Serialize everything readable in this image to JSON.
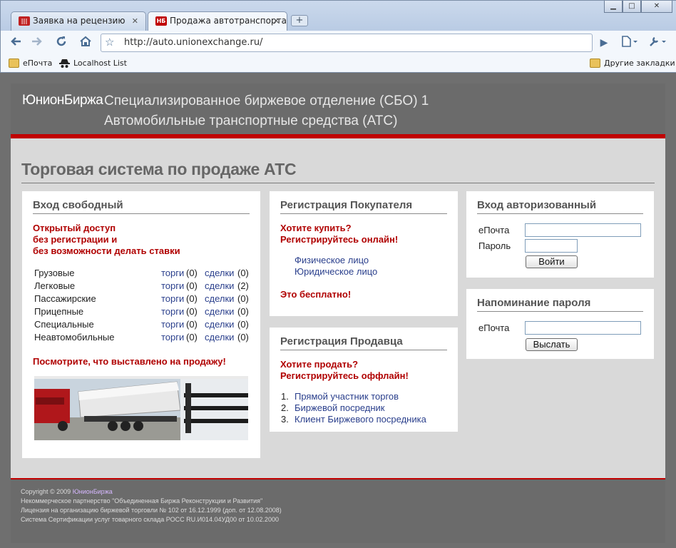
{
  "browser": {
    "tabs": [
      {
        "label": "Заявка на рецензию",
        "favicon_text": "|||",
        "favicon_color": "#c02020"
      },
      {
        "label": "Продажа автотранспорта",
        "favicon_text": "НБ",
        "favicon_color": "#c00000"
      }
    ],
    "new_tab_symbol": "+",
    "window_buttons": {
      "minimize": "▁",
      "maximize": "□",
      "close": "✕"
    },
    "tab_close_symbol": "✕",
    "address_url": "http://auto.unionexchange.ru/",
    "bookmarks": {
      "epochta": "еПочта",
      "localhost": "Localhost List",
      "other": "Другие закладки"
    }
  },
  "header": {
    "logo": "ЮнионБиржа",
    "line1": "Специализированное биржевое отделение (СБО) 1",
    "line2": "Автомобильные транспортные средства (АТС)"
  },
  "page_title": "Торговая система по продаже АТС",
  "free_entry": {
    "title": "Вход свободный",
    "notice": [
      "Открытый доступ",
      "без регистрации и",
      "без возможности делать ставки"
    ],
    "rows": [
      {
        "name": "Грузовые",
        "auctions_label": "торги",
        "auctions": "(0)",
        "deals_label": "сделки",
        "deals": "(0)"
      },
      {
        "name": "Легковые",
        "auctions_label": "торги",
        "auctions": "(0)",
        "deals_label": "сделки",
        "deals": "(2)"
      },
      {
        "name": "Пассажирские",
        "auctions_label": "торги",
        "auctions": "(0)",
        "deals_label": "сделки",
        "deals": "(0)"
      },
      {
        "name": "Прицепные",
        "auctions_label": "торги",
        "auctions": "(0)",
        "deals_label": "сделки",
        "deals": "(0)"
      },
      {
        "name": "Специальные",
        "auctions_label": "торги",
        "auctions": "(0)",
        "deals_label": "сделки",
        "deals": "(0)"
      },
      {
        "name": "Неавтомобильные",
        "auctions_label": "торги",
        "auctions": "(0)",
        "deals_label": "сделки",
        "deals": "(0)"
      }
    ],
    "see_for_sale": "Посмотрите, что выставлено на продажу!"
  },
  "buyer_registration": {
    "title": "Регистрация Покупателя",
    "prompt1": "Хотите купить?",
    "prompt2": "Регистрируйтесь онлайн!",
    "links": [
      "Физическое лицо",
      "Юридическое лицо"
    ],
    "free": "Это бесплатно!"
  },
  "seller_registration": {
    "title": "Регистрация Продавца",
    "prompt1": "Хотите продать?",
    "prompt2": "Регистрируйтесь оффлайн!",
    "items": [
      {
        "num": "1.",
        "label": "Прямой участник торгов"
      },
      {
        "num": "2.",
        "label": "Биржевой посредник"
      },
      {
        "num": "3.",
        "label": "Клиент Биржевого посредника"
      }
    ]
  },
  "auth_login": {
    "title": "Вход авторизованный",
    "email_label": "еПочта",
    "password_label": "Пароль",
    "email_value": "",
    "password_value": "",
    "submit": "Войти"
  },
  "password_reminder": {
    "title": "Напоминание пароля",
    "email_label": "еПочта",
    "email_value": "",
    "submit": "Выслать"
  },
  "footer": {
    "copyright_prefix": "Copyright © 2009",
    "copyright_link": "ЮнионБиржа",
    "line2": "Некоммерческое партнерство \"Объединенная Биржа Реконструкции и Развития\"",
    "line3": "Лицензия на организацию биржевой торговли № 102 от 16.12.1999 (доп. от 12.08.2008)",
    "line4": "Система Сертификации услуг товарного склада РОСС RU.И014.04УД00 от 10.02.2000"
  },
  "colors": {
    "accent_red": "#c00000",
    "link_blue": "#2a3f8c",
    "header_gray": "#6b6b6b"
  },
  "icons": [
    "back-icon",
    "forward-icon",
    "reload-icon",
    "home-icon",
    "bookmark-star-icon",
    "go-icon",
    "page-menu-icon",
    "wrench-icon",
    "folder-icon",
    "spy-icon"
  ]
}
